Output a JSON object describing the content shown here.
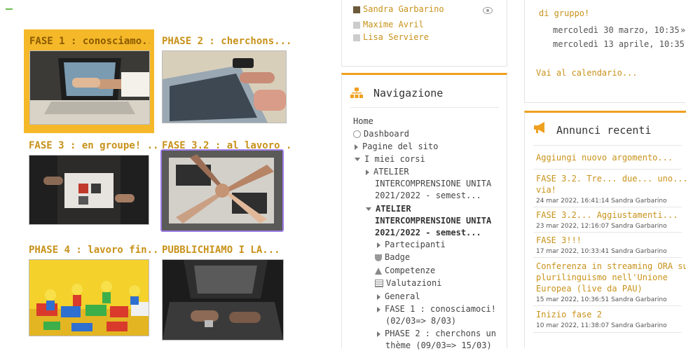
{
  "tiles": [
    {
      "title": "FASE 1 : conosciamo..."
    },
    {
      "title": "PHASE 2 : cherchons..."
    },
    {
      "title": "FASE 3 : en groupe! ..."
    },
    {
      "title": "FASE 3.2 : al lavoro ..."
    },
    {
      "title": "PHASE 4 : lavoro fin..."
    },
    {
      "title": "PUBBLICHIAMO I LA..."
    }
  ],
  "users": {
    "items": [
      "Sandra Garbarino",
      "Maxime Avril",
      "Lisa Serviere"
    ]
  },
  "navigation": {
    "title": "Navigazione",
    "home": "Home",
    "dashboard": "Dashboard",
    "site_pages": "Pagine del sito",
    "my_courses": "I miei corsi",
    "course1_line1": "ATELIER",
    "course1_line2": "INTERCOMPRENSIONE UNITA",
    "course1_line3": "2021/2022 - semest...",
    "course2_line1": "ATELIER",
    "course2_line2": "INTERCOMPRENSIONE UNITA",
    "course2_line3": "2021/2022 - semest...",
    "participants": "Partecipanti",
    "badge": "Badge",
    "competencies": "Competenze",
    "grades": "Valutazioni",
    "general": "General",
    "fase1_line1": "FASE 1 : conosciamoci!",
    "fase1_line2": "(02/03=> 8/03)",
    "phase2_line1": "PHASE 2 : cherchons un",
    "phase2_line2": "thème (09/03=> 15/03)"
  },
  "calendar": {
    "group_label": "di gruppo!",
    "date1": "mercoledì 30 marzo, 10:35",
    "date1_arrow": "»",
    "date2": "mercoledì 13 aprile, 10:35",
    "goto": "Vai al calendario..."
  },
  "announcements": {
    "title": "Annunci recenti",
    "add": "Aggiungi nuovo argomento...",
    "items": [
      {
        "t1": "FASE 3.2. Tre... due... uno...",
        "t2": "via!",
        "meta": "24 mar 2022, 16:41:14 Sandra Garbarino"
      },
      {
        "t1": "FASE 3.2... Aggiustamenti...",
        "meta": "23 mar 2022, 12:16:07 Sandra Garbarino"
      },
      {
        "t1": "FASE 3!!!",
        "meta": "17 mar 2022, 10:33:41 Sandra Garbarino"
      },
      {
        "t1": "Conferenza in streaming ORA sul",
        "t2": "plurilinguismo nell'Unione",
        "t3": "Europea (live da PAU)",
        "meta": "15 mar 2022, 10:36:51 Sandra Garbarino"
      },
      {
        "t1": "Inizio fase 2",
        "meta": "10 mar 2022, 11:38:07 Sandra Garbarino"
      }
    ]
  },
  "colors": {
    "accent": "#f5b828",
    "link": "#c8921a",
    "focus": "#9b7be6"
  }
}
